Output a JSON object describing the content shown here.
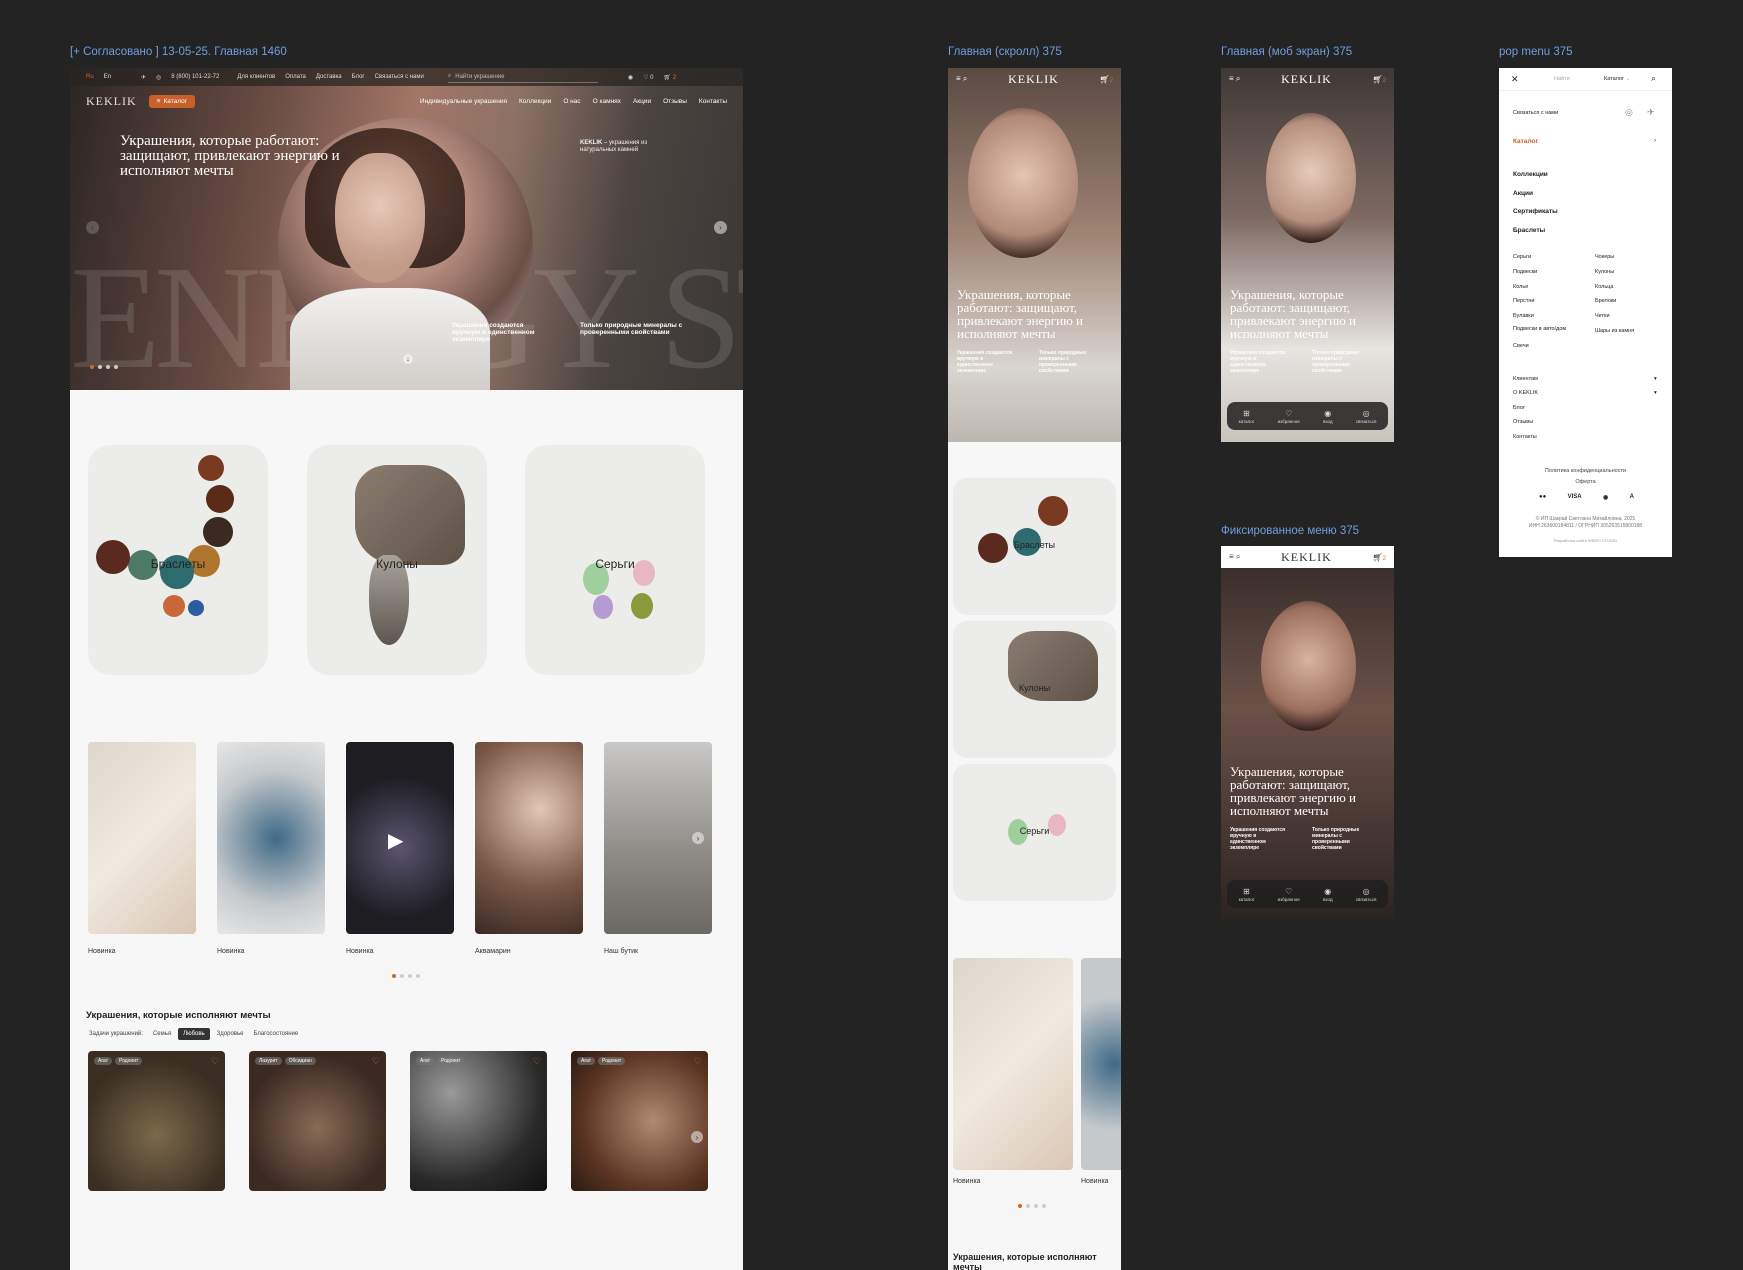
{
  "labels": {
    "desktop": "[+ Согласовано ] 13-05-25. Главная 1460",
    "scroll": "Главная (скролл) 375",
    "mobile": "Главная (моб экран) 375",
    "popmenu": "pop menu 375",
    "fixed": "Фиксированное меню 375"
  },
  "topbar": {
    "lang_ru": "Ru",
    "lang_en": "En",
    "phone": "8 (800) 101-22-72",
    "links": [
      "Для клиентов",
      "Оплата",
      "Доставка",
      "Блог",
      "Связаться с нами"
    ],
    "search_placeholder": "Найти украшение",
    "fav_count": "0",
    "cart_count": "2"
  },
  "nav": {
    "logo": "KEKLIK",
    "catalog": "Каталог",
    "items": [
      "Индивидуальные украшения",
      "Коллекции",
      "О нас",
      "О камнях",
      "Акции",
      "Отзывы",
      "Контакты"
    ]
  },
  "hero": {
    "title": "Украшения, которые работают: защищают, привлекают энергию и исполняют мечты",
    "side_brand": "KEKLIK",
    "side_text": " – украшения из натуральных камней",
    "note1": "Украшения создаются вручную в единственном экземпляре",
    "note2": "Только природные минералы с проверенными свойствами",
    "bg_letters": "ENERGY STONES"
  },
  "categories": [
    "Браслеты",
    "Кулоны",
    "Серьги"
  ],
  "stories": [
    "Новинка",
    "Новинка",
    "Новинка",
    "Аквамарин",
    "Наш бутик"
  ],
  "section": {
    "title": "Украшения, которые исполняют мечты",
    "filters": [
      "Задачи украшений:",
      "Семья",
      "Любовь",
      "Здоровье",
      "Благосостояние"
    ],
    "active_filter": "Любовь"
  },
  "products": [
    {
      "tags": [
        "Агат",
        "Родонит"
      ]
    },
    {
      "tags": [
        "Лазурит",
        "Обсидиан"
      ]
    },
    {
      "tags": [
        "Агат",
        "Родонит"
      ]
    },
    {
      "tags": [
        "Агат",
        "Родонит"
      ]
    }
  ],
  "mobile": {
    "logo": "KEKLIK",
    "cart_count": "2",
    "title": "Украшения, которые работают: защищают, привлекают энергию и исполняют мечты",
    "note1": "Украшения создаются вручную в единственном экземпляре",
    "note2": "Только природные минералы с проверенными свойствами",
    "bar": [
      "каталог",
      "избранное",
      "вход",
      "связаться"
    ],
    "section_title": "Украшения, которые исполняют мечты"
  },
  "popmenu": {
    "search": "Найти",
    "catalog_select": "Каталог",
    "contact": "Связаться с нами",
    "catalog": "Каталог",
    "main": [
      "Коллекции",
      "Акции",
      "Сертификаты",
      "Браслеты"
    ],
    "col1": [
      "Серьги",
      "Подвески",
      "Колье",
      "Перстни",
      "Булавки",
      "Подвески в авто/дом",
      "Свечи"
    ],
    "col2": [
      "Чокеры",
      "Кулоны",
      "Кольца",
      "Брелоки",
      "Четки",
      "Шары из камня"
    ],
    "extra": [
      "Клиентам",
      "О KEKLIK",
      "Блог",
      "Отзывы",
      "Контакты"
    ],
    "policy": "Политика конфиденциальности",
    "offer": "Оферта",
    "pay": [
      "●●",
      "VISA",
      "◉",
      "A"
    ],
    "copyright": "© ИП Шакрай Светлана Михайловна, 2025",
    "ids": "ИНН 263600184811 / ОГРНИП 305263515800188",
    "dev": "Разработка сайта WEBSI.STUDIO"
  },
  "colors": {
    "accent": "#c9602a",
    "label": "#6f9fdf",
    "canvas": "#232323"
  }
}
